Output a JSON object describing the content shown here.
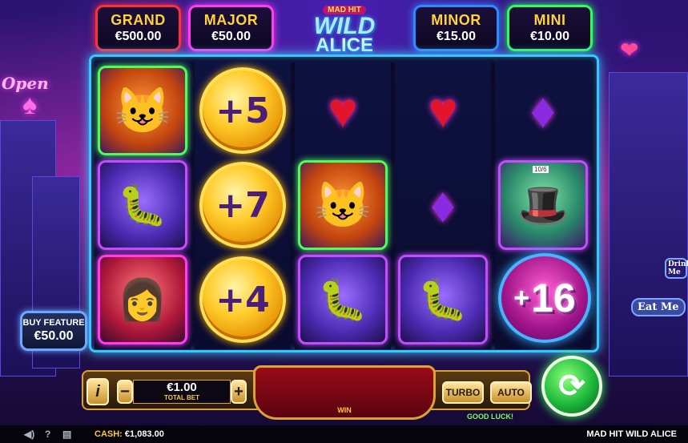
{
  "jackpots": {
    "grand": {
      "label": "GRAND",
      "amount": "€500.00"
    },
    "major": {
      "label": "MAJOR",
      "amount": "€50.00"
    },
    "minor": {
      "label": "MINOR",
      "amount": "€15.00"
    },
    "mini": {
      "label": "MINI",
      "amount": "€10.00"
    }
  },
  "logo": {
    "top": "MAD HIT",
    "line1": "WILD",
    "line2": "ALICE"
  },
  "background_signs": {
    "open": "Open",
    "eat_me": "Eat Me",
    "drink_me": "Drink Me"
  },
  "reels": {
    "coin1": "+5",
    "coin2": "+7",
    "coin3": "+4",
    "sticky_plus": "+",
    "sticky_value": "16",
    "hatter_hat": "10/6"
  },
  "buy_feature": {
    "label": "BUY FEATURE",
    "price": "€50.00"
  },
  "controls": {
    "info": "i",
    "minus": "−",
    "plus": "+",
    "bet_value": "€1.00",
    "bet_label": "TOTAL BET",
    "win_label": "WIN",
    "turbo": "TURBO",
    "auto": "AUTO",
    "good_luck": "GOOD LUCK!",
    "spin_icon": "⟳"
  },
  "status_bar": {
    "cash_label": "CASH:",
    "cash_value": "€1,083.00",
    "game_title": "MAD HIT WILD ALICE",
    "icons": [
      "mute-icon",
      "help-icon",
      "history-icon"
    ]
  }
}
